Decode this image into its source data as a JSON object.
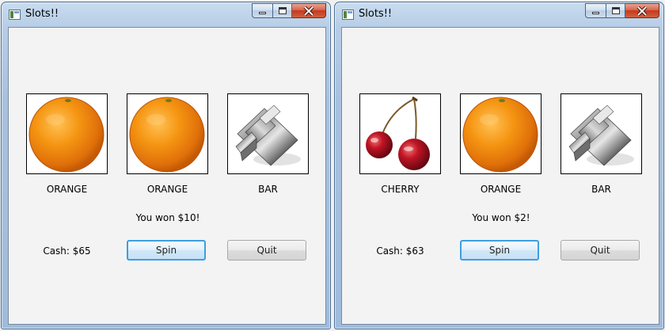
{
  "windows": [
    {
      "title": "Slots!!",
      "reels": [
        {
          "symbol": "orange-icon",
          "label": "ORANGE"
        },
        {
          "symbol": "orange-icon",
          "label": "ORANGE"
        },
        {
          "symbol": "bar-icon",
          "label": "BAR"
        }
      ],
      "message": "You won $10!",
      "cash": "Cash: $65",
      "spin_label": "Spin",
      "quit_label": "Quit"
    },
    {
      "title": "Slots!!",
      "reels": [
        {
          "symbol": "cherry-icon",
          "label": "CHERRY"
        },
        {
          "symbol": "orange-icon",
          "label": "ORANGE"
        },
        {
          "symbol": "bar-icon",
          "label": "BAR"
        }
      ],
      "message": "You won $2!",
      "cash": "Cash: $63",
      "spin_label": "Spin",
      "quit_label": "Quit"
    }
  ],
  "colors": {
    "focus_border": "#3c9fe0",
    "close_button": "#c23a1e",
    "orange": "#f08a10",
    "cherry": "#b3121e"
  }
}
